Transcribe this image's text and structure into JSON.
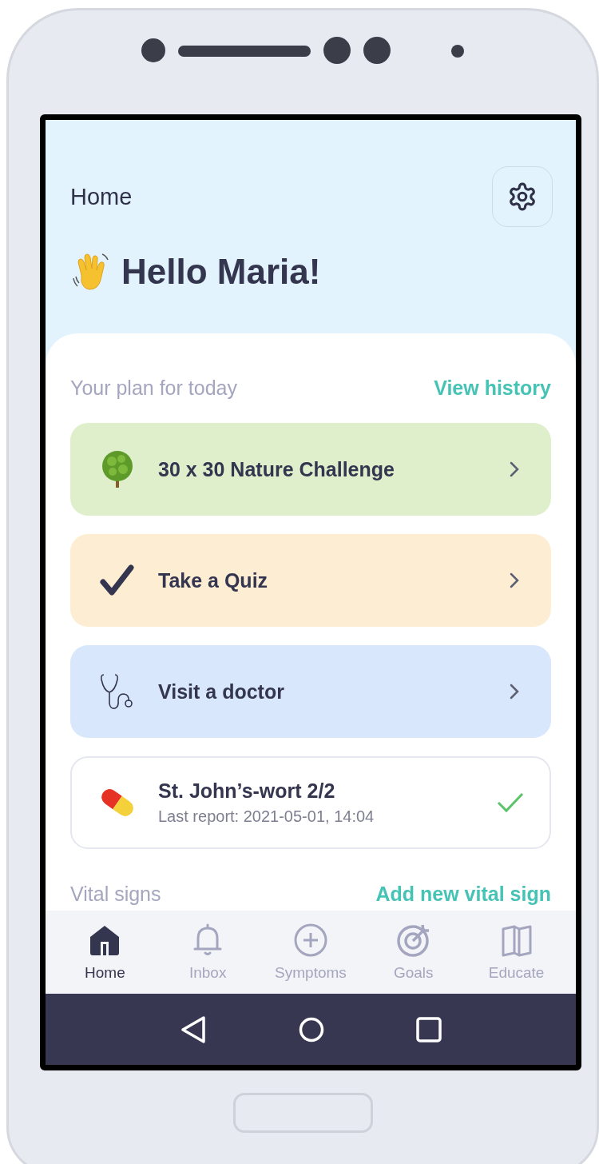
{
  "header": {
    "title": "Home",
    "greeting": "Hello Maria!"
  },
  "plan": {
    "heading": "Your plan for today",
    "link": "View history",
    "items": [
      {
        "kind": "task",
        "title": "30 x 30 Nature Challenge",
        "color": "#dfefcb"
      },
      {
        "kind": "task",
        "title": "Take a Quiz",
        "color": "#fdedd3"
      },
      {
        "kind": "task",
        "title": "Visit a doctor",
        "color": "#d8e7fb"
      },
      {
        "kind": "medication",
        "title": "St. John’s-wort 2/2",
        "subtitle": "Last report: 2021-05-01, 14:04",
        "done": true
      }
    ]
  },
  "vitals": {
    "heading": "Vital signs",
    "link": "Add new vital sign"
  },
  "tabs": [
    {
      "label": "Home",
      "selected": true
    },
    {
      "label": "Inbox",
      "selected": false
    },
    {
      "label": "Symptoms",
      "selected": false
    },
    {
      "label": "Goals",
      "selected": false
    },
    {
      "label": "Educate",
      "selected": false
    }
  ]
}
